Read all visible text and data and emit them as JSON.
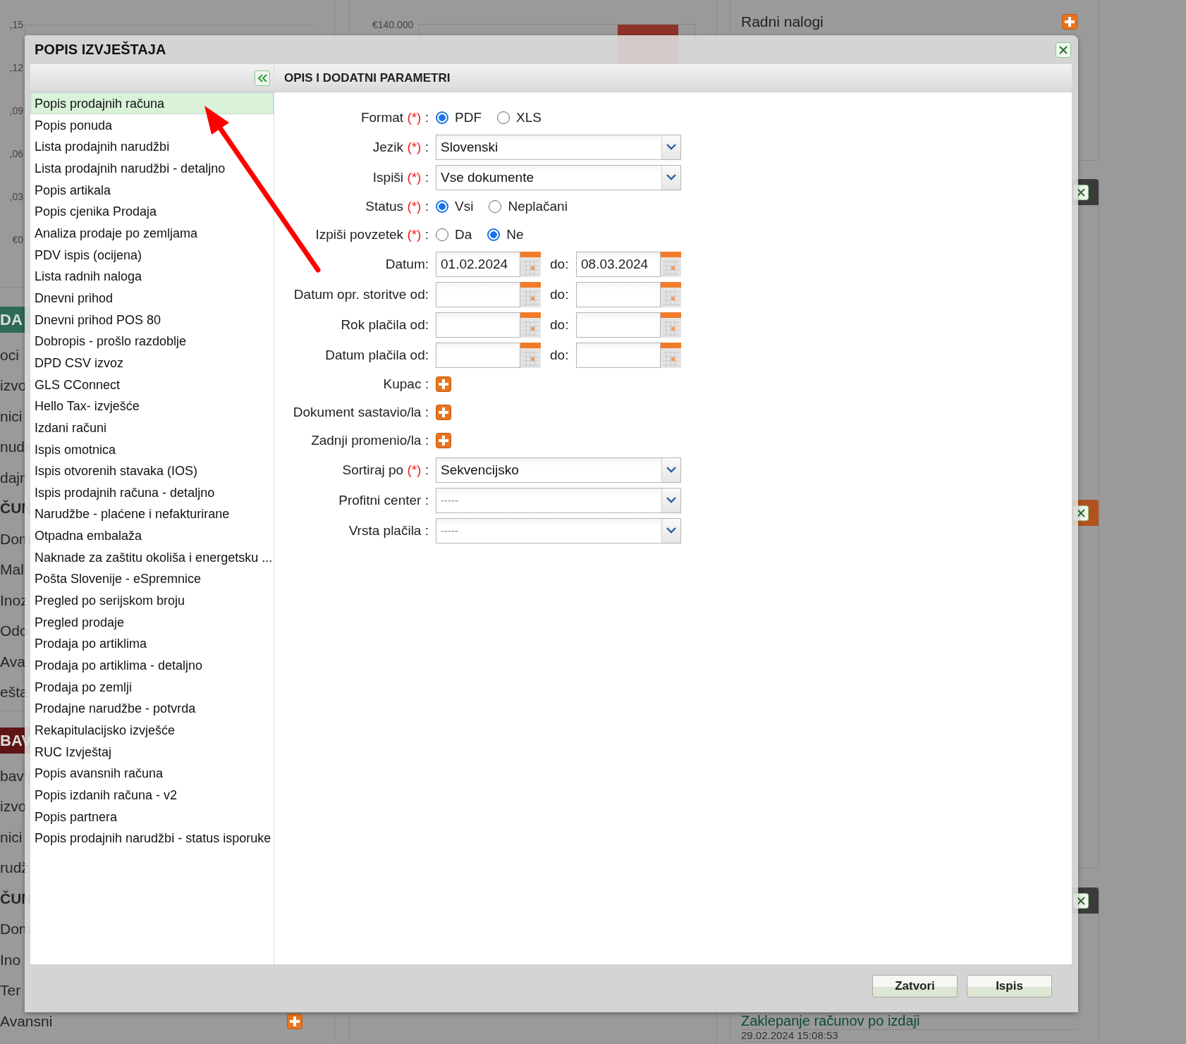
{
  "background": {
    "chart_panel": {
      "axis_labels": [
        ",15",
        ",12",
        ",09",
        ",06",
        ",03",
        "€0"
      ]
    },
    "sections": [
      {
        "title": "DA",
        "color": "#2f6a57",
        "items": [
          {
            "kind": "item",
            "label": "oci",
            "add": false
          },
          {
            "kind": "item",
            "label": "izvo",
            "add": false
          },
          {
            "kind": "item",
            "label": "nici",
            "add": false
          },
          {
            "kind": "item",
            "label": "nude",
            "add": false
          },
          {
            "kind": "item",
            "label": "dajn",
            "add": false
          },
          {
            "kind": "heading",
            "label": "ČUN",
            "add": false
          },
          {
            "kind": "item",
            "label": "Dom",
            "add": false
          },
          {
            "kind": "item",
            "label": "Mal",
            "add": false
          },
          {
            "kind": "item",
            "label": "Inoz",
            "add": false
          },
          {
            "kind": "item",
            "label": "Odo",
            "add": false
          },
          {
            "kind": "item",
            "label": "Ava",
            "add": false
          },
          {
            "kind": "item",
            "label": "ešta",
            "add": false
          }
        ]
      },
      {
        "title": "BAV",
        "color": "#5e1515",
        "items": [
          {
            "kind": "item",
            "label": "bavlj",
            "add": false
          },
          {
            "kind": "item",
            "label": "izvo",
            "add": false
          },
          {
            "kind": "item",
            "label": "nici",
            "add": false
          },
          {
            "kind": "item",
            "label": "rudž",
            "add": false
          },
          {
            "kind": "heading",
            "label": "ČUN",
            "add": false
          },
          {
            "kind": "item",
            "label": "Dom",
            "add": false
          },
          {
            "kind": "item",
            "label": "Ino",
            "add": false
          },
          {
            "kind": "item",
            "label": "Ter",
            "add": false
          },
          {
            "kind": "item",
            "label": "Avansni",
            "add": true
          }
        ]
      }
    ],
    "middle_panel": {
      "axis_label": "€140.000"
    },
    "right_panels": [
      {
        "kind": "plain",
        "title": "Radni nalogi",
        "add": true
      },
      {
        "kind": "header",
        "color": "#3b3b3b"
      },
      {
        "kind": "header",
        "color": "#b2521c"
      },
      {
        "kind": "header",
        "color": "#3b3b3b",
        "entries": [
          {
            "title": "Zaklepanje računov po izdaji"
          },
          {
            "time": "29.02.2024 15:08:53"
          }
        ]
      }
    ]
  },
  "dialog": {
    "title": "POPIS IZVJEŠTAJA",
    "report_list": {
      "items": [
        {
          "label": "Popis prodajnih računa",
          "selected": true
        },
        {
          "label": "Popis ponuda",
          "selected": false
        },
        {
          "label": "Lista prodajnih narudžbi",
          "selected": false
        },
        {
          "label": "Lista prodajnih narudžbi - detaljno",
          "selected": false
        },
        {
          "label": "Popis artikala",
          "selected": false
        },
        {
          "label": "Popis cjenika Prodaja",
          "selected": false
        },
        {
          "label": "Analiza prodaje po zemljama",
          "selected": false
        },
        {
          "label": "PDV ispis (ocijena)",
          "selected": false
        },
        {
          "label": "Lista radnih naloga",
          "selected": false
        },
        {
          "label": "Dnevni prihod",
          "selected": false
        },
        {
          "label": "Dnevni prihod POS 80",
          "selected": false
        },
        {
          "label": "Dobropis - prošlo razdoblje",
          "selected": false
        },
        {
          "label": "DPD CSV izvoz",
          "selected": false
        },
        {
          "label": "GLS CConnect",
          "selected": false
        },
        {
          "label": "Hello Tax- izvješće",
          "selected": false
        },
        {
          "label": "Izdani računi",
          "selected": false
        },
        {
          "label": "Ispis omotnica",
          "selected": false
        },
        {
          "label": "Ispis otvorenih stavaka (IOS)",
          "selected": false
        },
        {
          "label": "Ispis prodajnih računa - detaljno",
          "selected": false
        },
        {
          "label": "Narudžbe - plaćene i nefakturirane",
          "selected": false
        },
        {
          "label": "Otpadna embalaža",
          "selected": false
        },
        {
          "label": "Naknade za zaštitu okoliša i energetsku ...",
          "selected": false
        },
        {
          "label": "Pošta Slovenije - eSpremnice",
          "selected": false
        },
        {
          "label": "Pregled po serijskom broju",
          "selected": false
        },
        {
          "label": "Pregled prodaje",
          "selected": false
        },
        {
          "label": "Prodaja po artiklima",
          "selected": false
        },
        {
          "label": "Prodaja po artiklima - detaljno",
          "selected": false
        },
        {
          "label": "Prodaja po zemlji",
          "selected": false
        },
        {
          "label": "Prodajne narudžbe - potvrda",
          "selected": false
        },
        {
          "label": "Rekapitulacijsko izvješće",
          "selected": false
        },
        {
          "label": "RUC Izvještaj",
          "selected": false
        },
        {
          "label": "Popis avansnih računa",
          "selected": false
        },
        {
          "label": "Popis izdanih računa - v2",
          "selected": false
        },
        {
          "label": "Popis partnera",
          "selected": false
        },
        {
          "label": "Popis prodajnih narudžbi - status isporuke",
          "selected": false
        }
      ]
    },
    "parameters": {
      "title": "OPIS I DODATNI PARAMETRI",
      "fields": [
        {
          "kind": "radio",
          "label": "Format",
          "marker": "(*)",
          "suffix": ":",
          "options": [
            {
              "label": "PDF",
              "selected": true
            },
            {
              "label": "XLS",
              "selected": false
            }
          ]
        },
        {
          "kind": "select",
          "label": "Jezik",
          "marker": "(*)",
          "suffix": ":",
          "value": "Slovenski"
        },
        {
          "kind": "select",
          "label": "Ispiši",
          "marker": "(*)",
          "suffix": ":",
          "value": "Vse dokumente"
        },
        {
          "kind": "radio",
          "label": "Status",
          "marker": "(*)",
          "suffix": ":",
          "options": [
            {
              "label": "Vsi",
              "selected": true
            },
            {
              "label": "Neplačani",
              "selected": false
            }
          ]
        },
        {
          "kind": "radio",
          "label": "Izpiši povzetek",
          "marker": "(*)",
          "suffix": ":",
          "options": [
            {
              "label": "Da",
              "selected": false
            },
            {
              "label": "Ne",
              "selected": true
            }
          ]
        },
        {
          "kind": "date_range",
          "label": "Datum:",
          "to_label": "do:",
          "from_value": "01.02.2024",
          "to_value": "08.03.2024"
        },
        {
          "kind": "date_range",
          "label": "Datum opr. storitve od:",
          "to_label": "do:"
        },
        {
          "kind": "date_range",
          "label": "Rok plačila od:",
          "to_label": "do:"
        },
        {
          "kind": "date_range",
          "label": "Datum plačila od:",
          "to_label": "do:"
        },
        {
          "kind": "add",
          "label": "Kupac",
          "suffix": ":"
        },
        {
          "kind": "add",
          "label": "Dokument sastavio/la",
          "suffix": ":"
        },
        {
          "kind": "add",
          "label": "Zadnji promenio/la",
          "suffix": ":"
        },
        {
          "kind": "select",
          "label": "Sortiraj po",
          "marker": "(*)",
          "suffix": ":",
          "value": "Sekvencijsko"
        },
        {
          "kind": "select",
          "label": "Profitni center",
          "suffix": ":",
          "placeholder": "-----"
        },
        {
          "kind": "select",
          "label": "Vrsta plačila",
          "suffix": ":",
          "placeholder": "-----"
        }
      ]
    },
    "buttons": [
      "Zatvori",
      "Ispis"
    ]
  }
}
